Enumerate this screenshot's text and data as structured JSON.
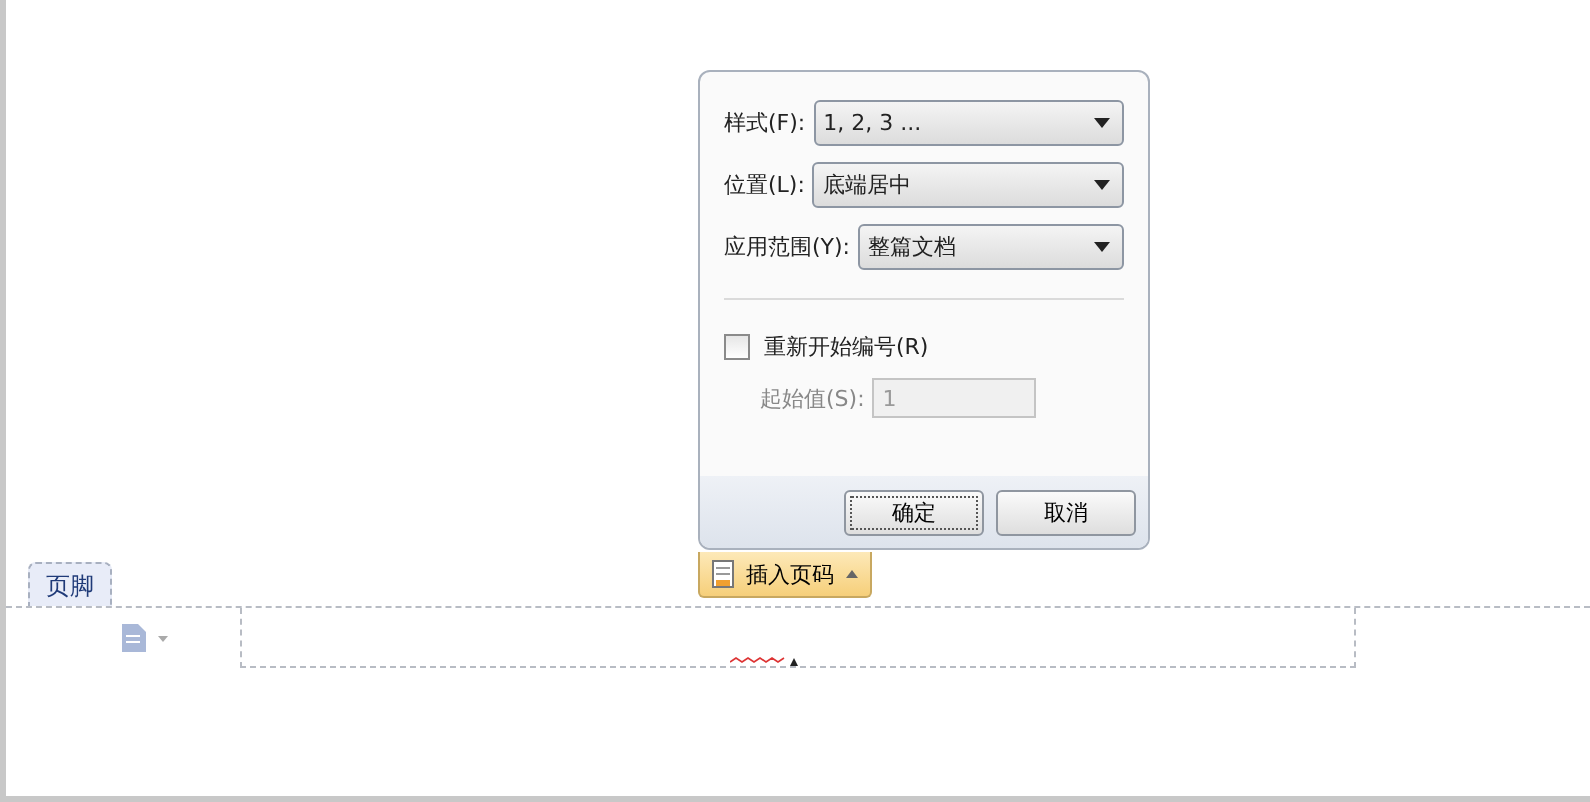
{
  "dialog": {
    "fields": [
      {
        "label": "样式(F):",
        "value": "1, 2, 3 ..."
      },
      {
        "label": "位置(L):",
        "value": "底端居中"
      },
      {
        "label": "应用范围(Y):",
        "value": "整篇文档"
      }
    ],
    "restart": {
      "label": "重新开始编号(R)",
      "checked": false
    },
    "start": {
      "label": "起始值(S):",
      "value": "1",
      "disabled": true
    },
    "buttons": [
      {
        "label": "确定",
        "kind": "default"
      },
      {
        "label": "取消",
        "kind": "normal"
      }
    ]
  },
  "insert_tab": {
    "label": "插入页码",
    "expanded": true
  },
  "footer_tag": "页脚"
}
